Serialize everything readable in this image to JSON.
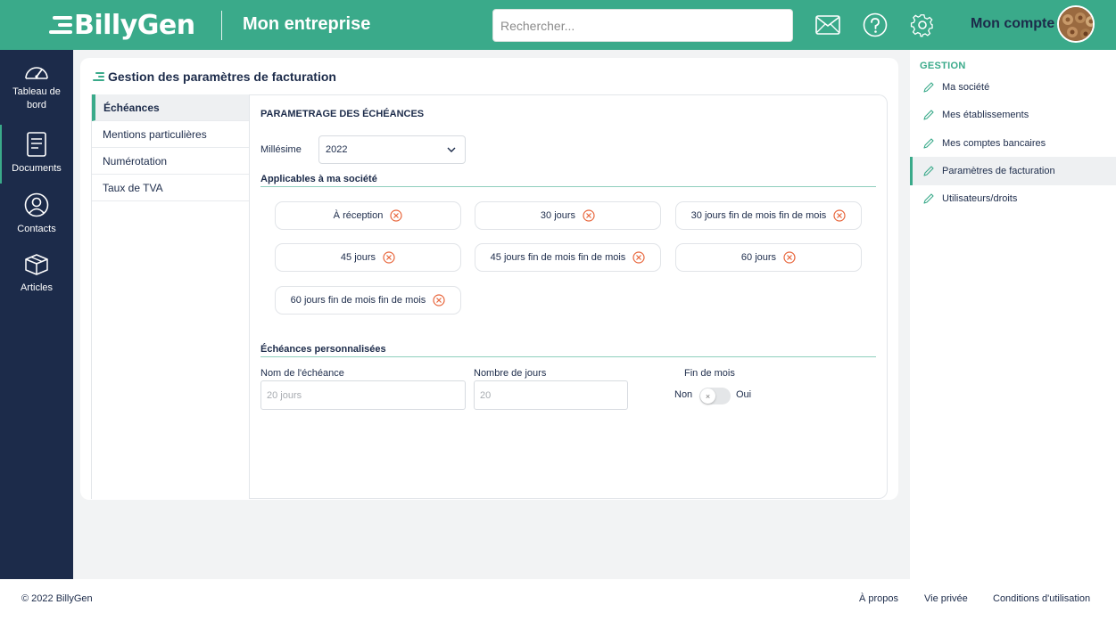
{
  "header": {
    "logo_text": "BillyGen",
    "company_name": "Mon entreprise",
    "search_placeholder": "Rechercher...",
    "account_label": "Mon compte",
    "icons": [
      "mail-icon",
      "help-icon",
      "gear-icon"
    ]
  },
  "sidebar": {
    "items": [
      {
        "label": "Tableau de bord",
        "icon": "dashboard-gauge-icon"
      },
      {
        "label": "Documents",
        "icon": "document-icon"
      },
      {
        "label": "Contacts",
        "icon": "user-icon"
      },
      {
        "label": "Articles",
        "icon": "box-icon"
      }
    ],
    "active_index": 1
  },
  "main": {
    "title": "Gestion des paramètres de facturation",
    "tabs": [
      {
        "label": "Échéances",
        "active": true
      },
      {
        "label": "Mentions particulières"
      },
      {
        "label": "Numérotation"
      },
      {
        "label": "Taux de TVA"
      }
    ],
    "section_title": "PARAMETRAGE DES ÉCHÉANCES",
    "millesime_label": "Millésime",
    "millesime_value": "2022",
    "applicable_title": "Applicables à ma société",
    "chips": [
      "À réception",
      "30 jours",
      "30 jours fin de mois fin de mois",
      "45 jours",
      "45 jours fin de mois fin de mois",
      "60 jours",
      "60 jours fin de mois fin de mois"
    ],
    "custom_title": "Échéances personnalisées",
    "name_label": "Nom de l'échéance",
    "name_placeholder": "20 jours",
    "days_label": "Nombre de jours",
    "days_placeholder": "20",
    "end_month_label": "Fin de mois",
    "toggle_off_label": "Non",
    "toggle_on_label": "Oui",
    "toggle_value": false
  },
  "right_panel": {
    "heading": "GESTION",
    "items": [
      {
        "label": "Ma société"
      },
      {
        "label": "Mes établissements"
      },
      {
        "label": "Mes comptes bancaires"
      },
      {
        "label": "Paramètres de facturation",
        "active": true
      },
      {
        "label": "Utilisateurs/droits"
      }
    ]
  },
  "footer": {
    "copyright": "© 2022 BillyGen",
    "links": [
      "À propos",
      "Vie privée",
      "Conditions d'utilisation"
    ]
  },
  "colors": {
    "brand_green": "#3aaa8a",
    "navy": "#1c2b4a",
    "remove_orange": "#e8663c"
  }
}
